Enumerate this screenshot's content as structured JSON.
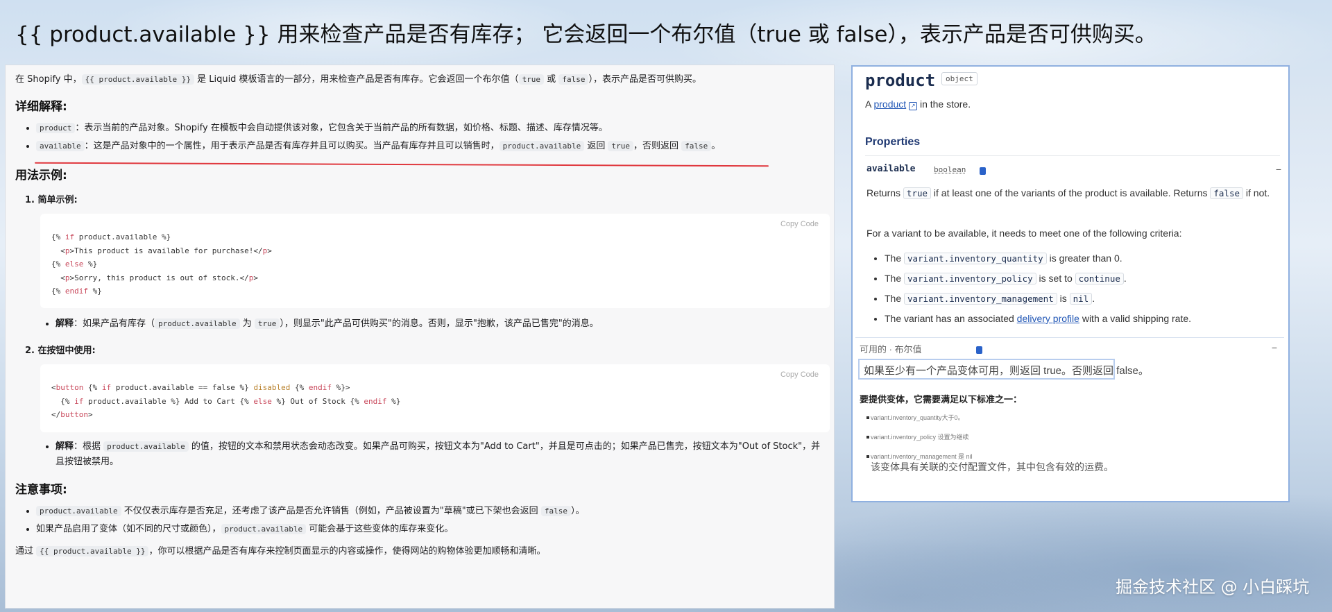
{
  "headline": "{{ product.available }}  用来检查产品是否有库存；  它会返回一个布尔值（true 或 false），表示产品是否可供购买。",
  "left": {
    "intro_pre": "在 Shopify 中，",
    "intro_code1": "{{ product.available }}",
    "intro_mid": " 是 Liquid 模板语言的一部分，用来检查产品是否有库存。它会返回一个布尔值（",
    "intro_code2": "true",
    "intro_or": " 或 ",
    "intro_code3": "false",
    "intro_post": "），表示产品是否可供购买。",
    "h_detail": "详细解释:",
    "d1_code": "product",
    "d1_text": "：表示当前的产品对象。Shopify 在模板中会自动提供该对象，它包含关于当前产品的所有数据，如价格、标题、描述、库存情况等。",
    "d2_code": "available",
    "d2_text1": "：这是产品对象中的一个属性，用于表示产品是否有库存并且可以购买。当产品有库存并且可以销售时，",
    "d2_code2": "product.available",
    "d2_text2": " 返回 ",
    "d2_code3": "true",
    "d2_text3": "，否则返回 ",
    "d2_code4": "false",
    "d2_text4": "。",
    "h_usage": "用法示例:",
    "ex1_title": "1. 简单示例:",
    "copy_label": "Copy  Code",
    "ex1_exp_label": "解释",
    "ex1_exp_pre": "：如果产品有库存（",
    "ex1_exp_code": "product.available",
    "ex1_exp_mid": " 为 ",
    "ex1_exp_code2": "true",
    "ex1_exp_post": "），则显示\"此产品可供购买\"的消息。否则，显示\"抱歉，该产品已售完\"的消息。",
    "ex2_title": "2. 在按钮中使用:",
    "ex2_exp_label": "解释",
    "ex2_exp_pre": "：根据 ",
    "ex2_exp_code": "product.available",
    "ex2_exp_post": " 的值，按钮的文本和禁用状态会动态改变。如果产品可购买，按钮文本为\"Add to Cart\"，并且是可点击的；如果产品已售完，按钮文本为\"Out of Stock\"，并且按钮被禁用。",
    "h_notes": "注意事项:",
    "n1_code": "product.available",
    "n1_text": " 不仅仅表示库存是否充足，还考虑了该产品是否允许销售（例如，产品被设置为\"草稿\"或已下架也会返回 ",
    "n1_code2": "false",
    "n1_post": "）。",
    "n2_text": "如果产品启用了变体（如不同的尺寸或颜色），",
    "n2_code": "product.available",
    "n2_post": " 可能会基于这些变体的库存来变化。",
    "outro_pre": "通过 ",
    "outro_code": "{{ product.available }}",
    "outro_post": "，你可以根据产品是否有库存来控制页面显示的内容或操作，使得网站的购物体验更加顺畅和清晰。"
  },
  "right": {
    "name": "product",
    "tag": "object",
    "sub_pre": "A ",
    "sub_link": "product",
    "sub_post": " in the store.",
    "props": "Properties",
    "prop_name": "available",
    "prop_type": "boolean",
    "r1_pre": "Returns ",
    "r1_c1": "true",
    "r1_mid": " if at least one of the variants of the product is available. Returns ",
    "r1_c2": "false",
    "r1_post": " if not.",
    "r2": "For a variant to be available, it needs to meet one of the following criteria:",
    "li_the": "The ",
    "li1_code": "variant.inventory_quantity",
    "li1_post": " is greater than 0.",
    "li2_code": "variant.inventory_policy",
    "li2_mid": " is set to ",
    "li2_code2": "continue",
    "li2_post": ".",
    "li3_code": "variant.inventory_management",
    "li3_mid": " is ",
    "li3_code2": "nil",
    "li3_post": ".",
    "li4_pre": "The variant has an associated ",
    "li4_link": "delivery profile",
    "li4_post": " with a valid shipping rate.",
    "minus": "−"
  },
  "overlay": {
    "label": "可用的 · 布尔值",
    "box": "如果至少有一个产品变体可用，则返回 true。否则返回 false。",
    "head": "要提供变体，它需要满足以下标准之一：",
    "i1": "variant.inventory_quantity大于0。",
    "i2": "variant.inventory_policy 设置为继续",
    "i3": "variant.inventory_management 是 nil",
    "i4": "该变体具有关联的交付配置文件，其中包含有效的运费。"
  },
  "watermark": "掘金技术社区 @ 小白踩坑",
  "colors": {
    "accent_red": "#e0383e",
    "link_blue": "#2358b6",
    "panel_border": "#8fb0e0"
  }
}
